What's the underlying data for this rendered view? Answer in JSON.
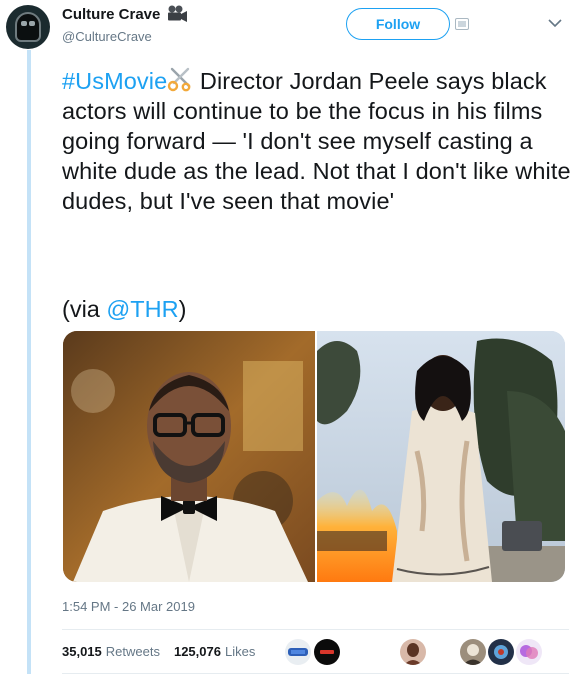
{
  "account": {
    "display_name": "Culture Crave",
    "handle": "@CultureCrave"
  },
  "actions": {
    "follow_label": "Follow"
  },
  "tweet": {
    "hashtag": "#UsMovie",
    "body": " Director Jordan Peele says black actors will continue to be the focus in his films going forward — 'I don't see myself casting a white dude as the lead. Not that I don't like white dudes, but I've seen that movie'",
    "via_prefix": "(via ",
    "via_mention": "@THR",
    "via_suffix": ")",
    "timestamp": "1:54 PM - 26 Mar 2019"
  },
  "stats": {
    "retweets_count": "35,015",
    "retweets_label": "Retweets",
    "likes_count": "125,076",
    "likes_label": "Likes"
  },
  "colors": {
    "link": "#1da1f2",
    "secondary_text": "#657786",
    "thread_line": "#c4e2f7"
  },
  "icons": [
    "camera-emoji-icon",
    "scissors-emoji-icon",
    "add-photo-icon",
    "chevron-down-icon"
  ]
}
